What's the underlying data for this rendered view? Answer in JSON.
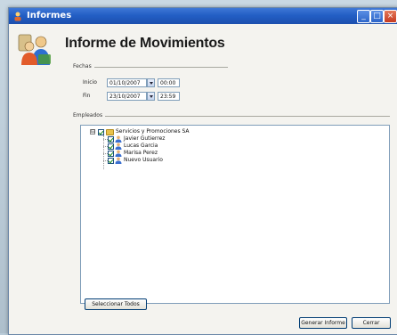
{
  "window": {
    "title": "Informes",
    "controls": {
      "minimize": "_",
      "maximize": "□",
      "close": "×"
    }
  },
  "header": {
    "title": "Informe de Movimientos",
    "icon": "users-icon"
  },
  "fechas": {
    "group_label": "Fechas",
    "inicio": {
      "label": "Inicio",
      "date": "01/10/2007",
      "time": "00:00"
    },
    "fin": {
      "label": "Fin",
      "date": "23/10/2007",
      "time": "23:59"
    }
  },
  "empleados": {
    "group_label": "Empleados",
    "expander": "⊟",
    "root": {
      "label": "Servicios y Promociones SA",
      "checked": true,
      "icon": "folder-icon"
    },
    "children": [
      {
        "label": "Javier Gutierrez",
        "checked": true,
        "icon": "user-icon"
      },
      {
        "label": "Lucas Garcia",
        "checked": true,
        "icon": "user-icon"
      },
      {
        "label": "Marisa Perez",
        "checked": true,
        "icon": "user-icon"
      },
      {
        "label": "Nuevo Usuario",
        "checked": true,
        "icon": "user-icon"
      }
    ]
  },
  "buttons": {
    "select_all": "Seleccionar Todos",
    "generate": "Generar Informe",
    "cancel": "Cerrar"
  },
  "colors": {
    "titlebar": "#235fc5",
    "window_bg": "#f4f3ef",
    "border_blue": "#7f9db9"
  }
}
